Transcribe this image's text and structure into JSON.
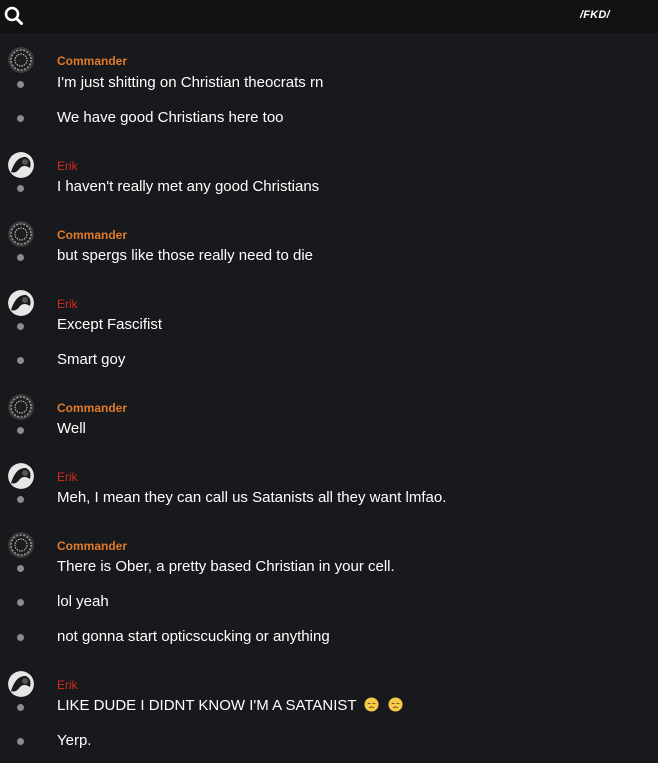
{
  "header": {
    "channel": "/FKD/",
    "search_icon": "search-icon"
  },
  "colors": {
    "background": "#18191c",
    "topbar": "#121214",
    "commander": "#e07a2c",
    "erik": "#d42a22",
    "message_text": "#ffffff",
    "dot": "#8a8c90"
  },
  "users": {
    "commander": "Commander",
    "erik": "Erik"
  },
  "messages": [
    {
      "author": "Commander",
      "text": "I'm just shitting on Christian theocrats rn"
    },
    {
      "text": "We have good Christians here too"
    },
    {
      "author": "Erik",
      "text": "I haven't really met any good Christians"
    },
    {
      "author": "Commander",
      "text": "but spergs like those really need to die"
    },
    {
      "author": "Erik",
      "text": "Except Fascifist"
    },
    {
      "text": "Smart goy"
    },
    {
      "author": "Commander",
      "text": "Well"
    },
    {
      "author": "Erik",
      "text": "Meh, I mean they can call us Satanists all they want lmfao."
    },
    {
      "author": "Commander",
      "text": "There is Ober, a pretty based Christian in your cell."
    },
    {
      "text": "lol yeah"
    },
    {
      "text": "not gonna start opticscucking or anything"
    },
    {
      "author": "Erik",
      "text": "LIKE DUDE I DIDNT KNOW I'M A SATANIST",
      "emoji": "disappointed-face-icon"
    },
    {
      "text": "Yerp."
    }
  ]
}
